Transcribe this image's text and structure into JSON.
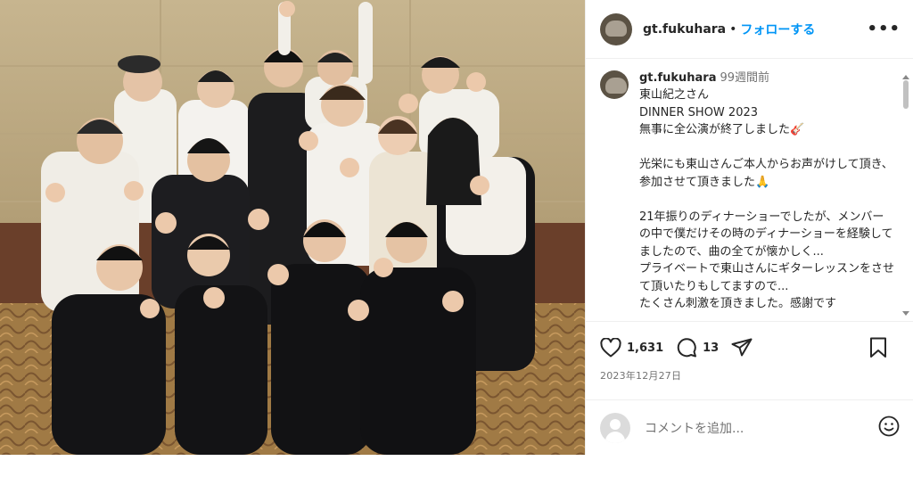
{
  "post": {
    "username": "gt.fukuhara",
    "separator": "•",
    "follow_label": "フォローする",
    "more_label": "•••"
  },
  "caption": {
    "username": "gt.fukuhara",
    "time": "99週間前",
    "text": "東山紀之さん\nDINNER SHOW 2023\n無事に全公演が終了しました🎸\n\n光栄にも東山さんご本人からお声がけして頂き、参加させて頂きました🙏\n\n21年振りのディナーショーでしたが、メンバーの中で僕だけその時のディナーショーを経験してましたので、曲の全てが懐かしく...\nプライベートで東山さんにギターレッスンをさせて頂いたりもしてますので...\nたくさん刺激を頂きました。感謝です"
  },
  "actions": {
    "likes": "1,631",
    "comments": "13",
    "date": "2023年12月27日"
  },
  "comment_box": {
    "placeholder": "コメントを追加..."
  },
  "icons": {
    "like": "heart-icon",
    "comment": "comment-icon",
    "share": "send-icon",
    "save": "bookmark-icon",
    "emoji": "emoji-icon",
    "more": "more-icon"
  },
  "colors": {
    "follow": "#0095f6",
    "text": "#262626",
    "muted": "#737373"
  }
}
